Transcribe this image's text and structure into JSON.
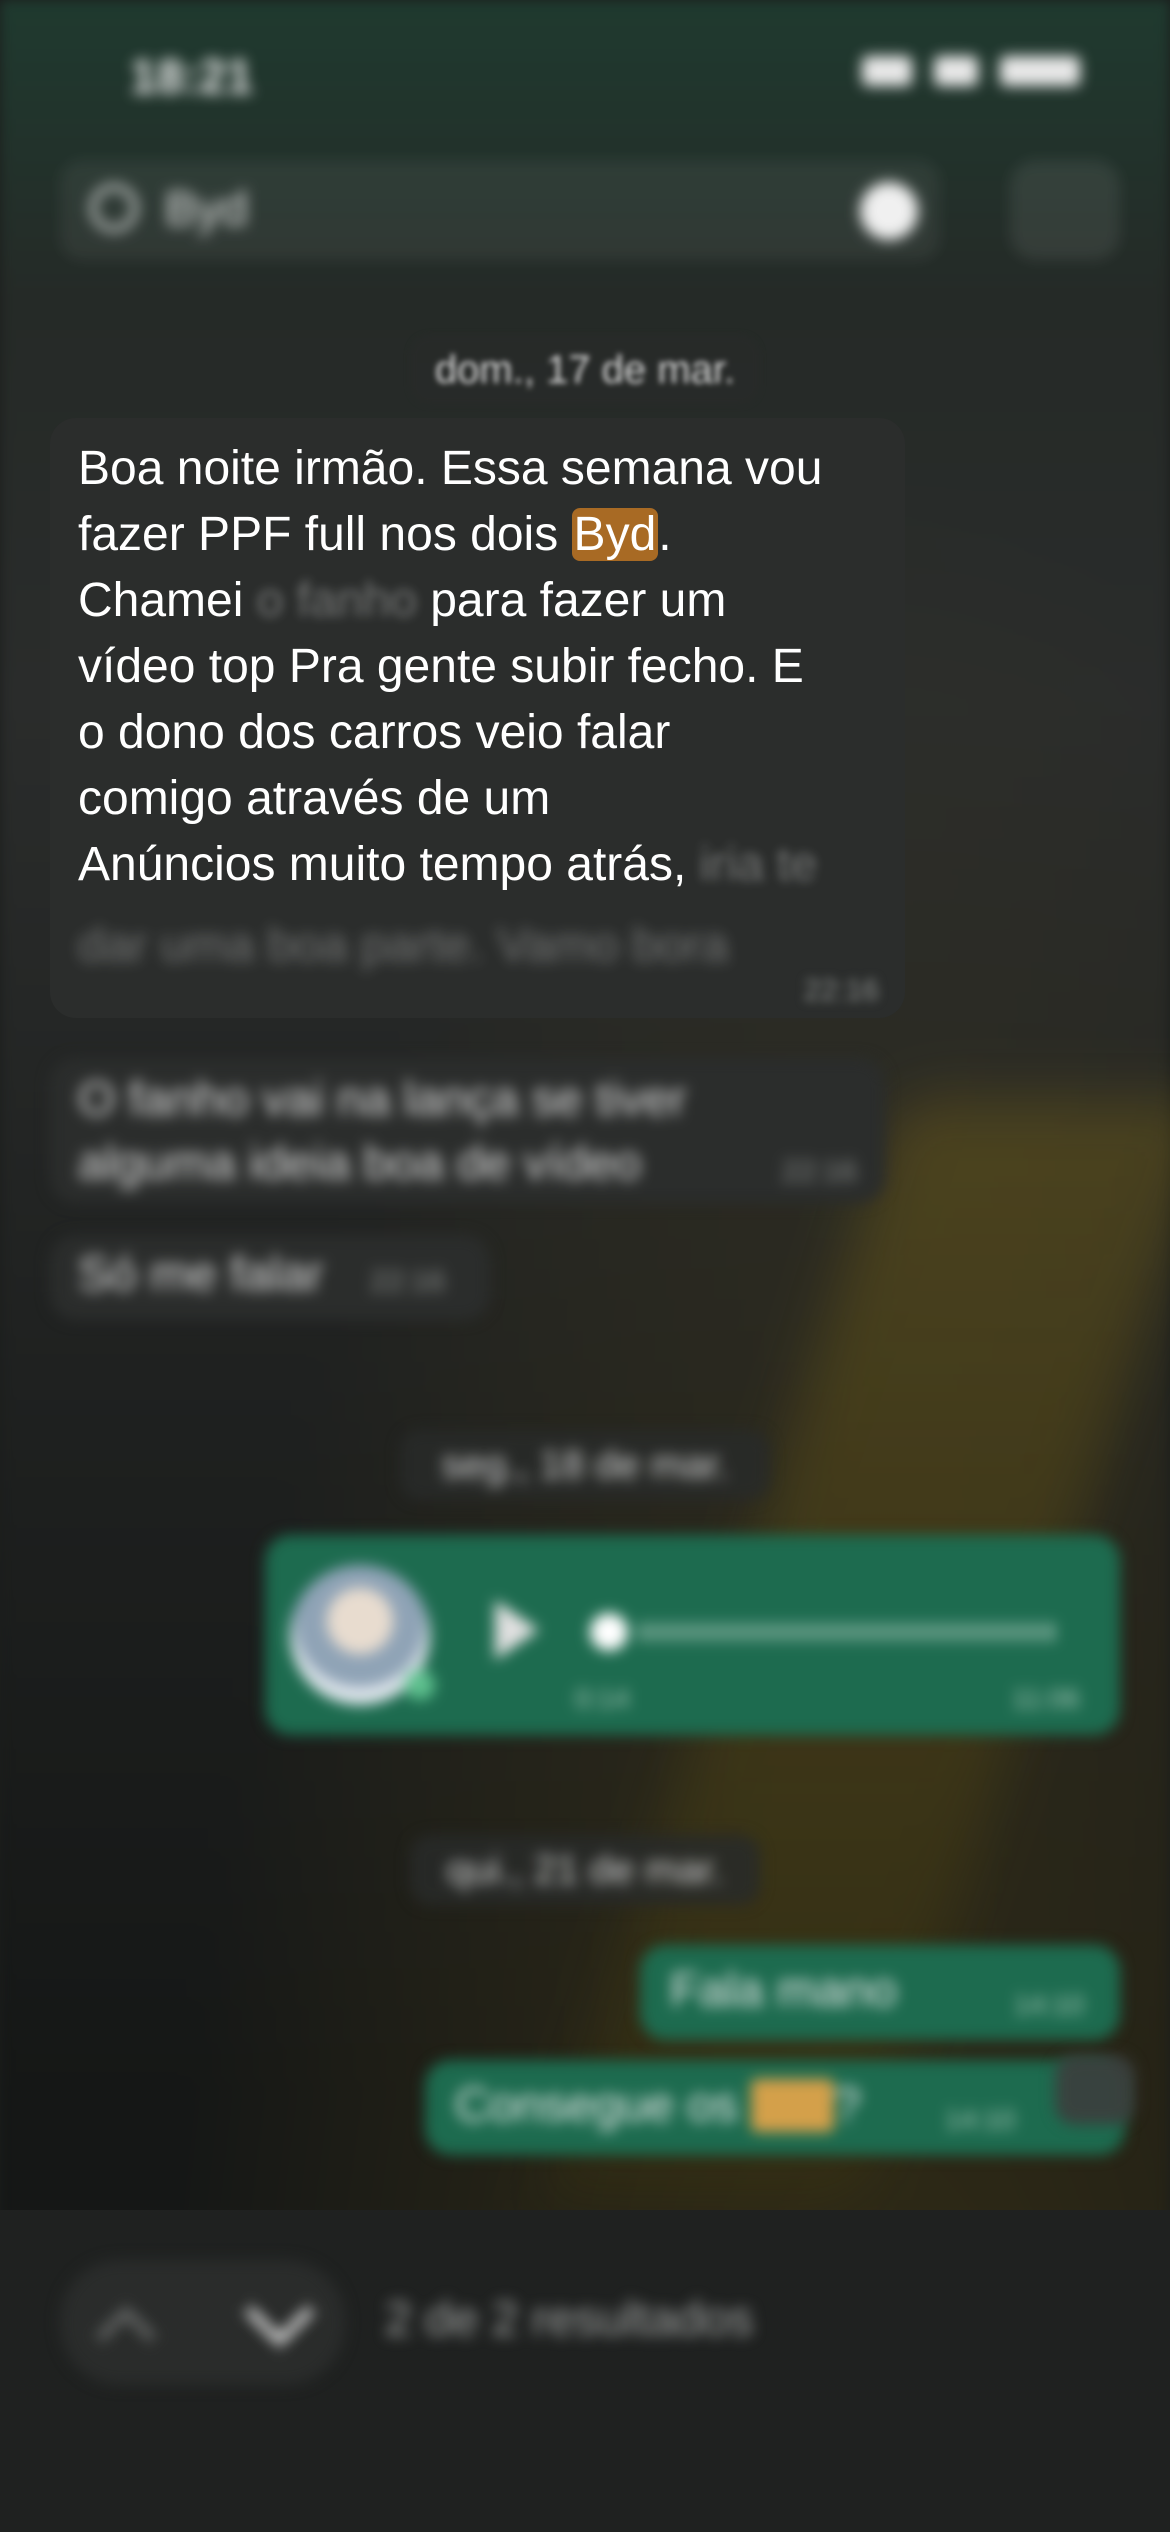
{
  "status_bar": {
    "time": "18:21"
  },
  "search": {
    "query": "Byd"
  },
  "date_separators": [
    "dom., 17 de mar.",
    "seg., 18 de mar.",
    "qui., 21 de mar."
  ],
  "messages": {
    "main": {
      "line1": "Boa noite irmão. Essa semana vou",
      "line2_pre": "fazer PPF full nos dois ",
      "highlight": "Byd",
      "line2_post": ".",
      "line3_pre": "Chamei",
      "line3_soft": " o fanho",
      "line3_post": " para fazer um",
      "line4": "vídeo top Pra gente subir fecho. E",
      "line5": "o dono dos carros veio falar",
      "line6": "comigo através de um",
      "line7": "Anúncios muito tempo atrás,",
      "line7_soft": " iria te",
      "tail": "dar uma boa parte. Vamo bora",
      "time": "22:16"
    },
    "second": {
      "text": "O fanho vai na lança se tiver alguma ideia boa de vídeo",
      "time": "22:16"
    },
    "third": {
      "text": "Só me falar",
      "time": "22:16"
    },
    "voice": {
      "duration": "0:14",
      "time": "11:06"
    },
    "fourth": {
      "text": "Fala mano",
      "time": "14:10"
    },
    "fifth": {
      "text_pre": "Consegue os ",
      "highlight": "Byd",
      "text_post": "?",
      "time": "14:10"
    }
  },
  "bottom_bar": {
    "results": "2 de 2 resultados"
  },
  "icons": [
    "search-icon",
    "clear-icon",
    "close-icon",
    "play-icon",
    "mic-icon",
    "chevron-down-icon",
    "chevron-up-icon"
  ],
  "colors": {
    "highlight": "#a86a24",
    "outgoing_bubble": "#1d6b4f",
    "incoming_bubble": "#2b2d2c"
  }
}
